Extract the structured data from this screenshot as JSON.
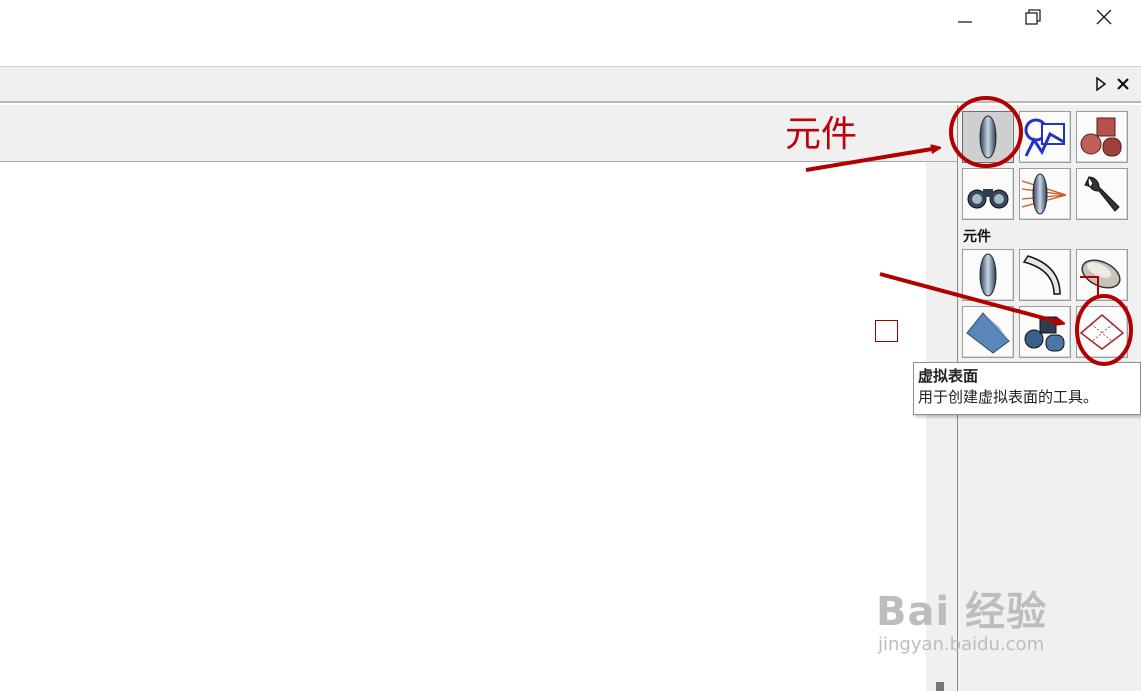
{
  "window": {
    "minimize_icon": "minimize-icon",
    "restore_icon": "restore-icon",
    "close_icon": "close-icon"
  },
  "panel": {
    "collapse_icon": "triangle-right-icon",
    "close_icon": "close-icon"
  },
  "palette": {
    "top_buttons": [
      "lens-icon",
      "analysis-icon",
      "solids-icon",
      "binoculars-icon",
      "raytrace-icon",
      "wrench-icon"
    ],
    "section_label": "元件",
    "section_buttons": [
      "lens-icon",
      "mirror-icon",
      "dish-icon",
      "prism-icon",
      "primitives-icon",
      "dummy-surface-icon"
    ]
  },
  "tooltip": {
    "title": "虚拟表面",
    "description": "用于创建虚拟表面的工具。"
  },
  "annotation": {
    "label": "元件",
    "color": "#c0000c"
  },
  "watermark": {
    "main": "Bai 经验",
    "sub": "jingyan.baidu.com"
  }
}
